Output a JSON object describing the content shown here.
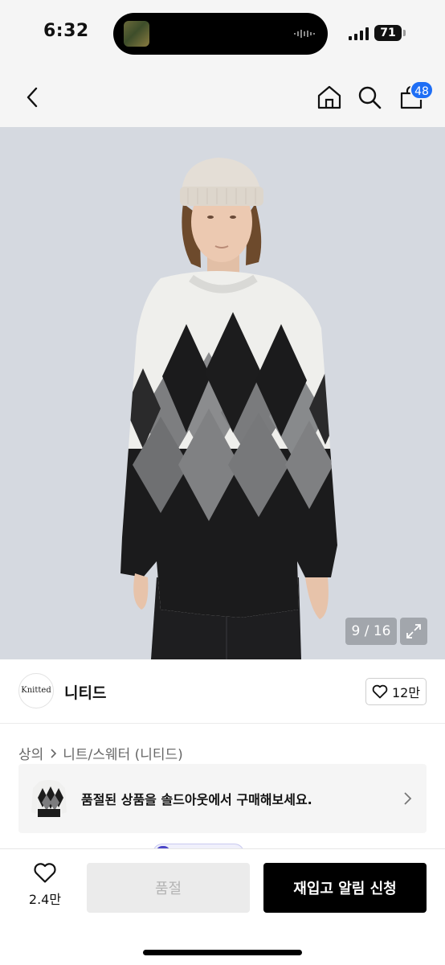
{
  "status_bar": {
    "time": "6:32",
    "battery": "71"
  },
  "nav": {
    "back_icon": "chevron-left-icon",
    "home_icon": "home-icon",
    "search_icon": "search-icon",
    "cart_icon": "shopping-bag-icon",
    "cart_count": "48",
    "badge_color": "#1e6ef5"
  },
  "product_image": {
    "counter": "9 / 16",
    "expand_icon": "expand-icon"
  },
  "brand": {
    "logo_text": "Knitted",
    "name": "니티드",
    "like_count": "12만"
  },
  "breadcrumb": {
    "category": "상의",
    "subcategory": "니트/스웨터 (니티드)"
  },
  "soldout_banner": {
    "text": "품절된 상품을 솔드아웃에서 구매해보세요."
  },
  "bottom_bar": {
    "wish_count": "2.4만",
    "soldout_label": "품절",
    "restock_label": "재입고 알림 신청"
  }
}
